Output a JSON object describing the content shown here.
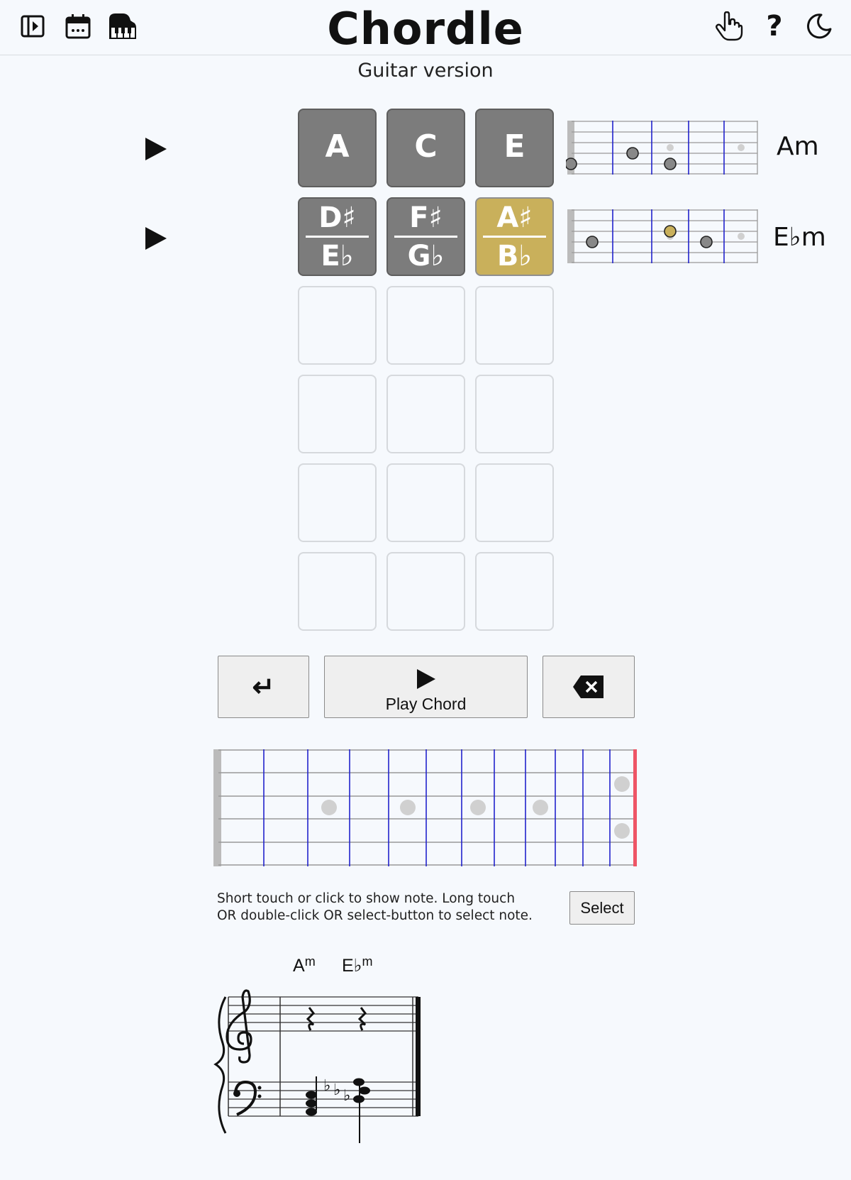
{
  "header": {
    "title": "Chordle",
    "subtitle": "Guitar version",
    "left_icons": [
      "sidebar-toggle-icon",
      "calendar-icon",
      "piano-icon"
    ],
    "right_icons": [
      "pointer-hand-icon",
      "help-icon",
      "dark-mode-icon"
    ],
    "help_glyph": "?"
  },
  "board": {
    "rows": [
      {
        "chord": "Am",
        "tiles": [
          {
            "top": "A",
            "bottom": "",
            "state": "absent"
          },
          {
            "top": "C",
            "bottom": "",
            "state": "absent"
          },
          {
            "top": "E",
            "bottom": "",
            "state": "absent"
          }
        ]
      },
      {
        "chord": "E♭m",
        "tiles": [
          {
            "top": "D♯",
            "bottom": "E♭",
            "state": "absent"
          },
          {
            "top": "F♯",
            "bottom": "G♭",
            "state": "absent"
          },
          {
            "top": "A♯",
            "bottom": "B♭",
            "state": "present"
          }
        ]
      }
    ],
    "empty_rows": 4
  },
  "controls": {
    "enter_glyph": "↵",
    "play_label": "Play Chord",
    "backspace_glyph": "✕"
  },
  "instructions": {
    "line1": "Short touch or click to show note. Long touch",
    "line2": "OR double-click OR select-button to select note.",
    "select_label": "Select"
  },
  "score": {
    "chord1": {
      "root": "A",
      "quality": "m"
    },
    "chord2": {
      "root": "E♭",
      "quality": "m"
    }
  },
  "colors": {
    "absent": "#7c7c7c",
    "present": "#c9b05b",
    "fret_line": "#2222cc",
    "nut": "#bbbbbb",
    "end_marker": "#ee5566"
  }
}
